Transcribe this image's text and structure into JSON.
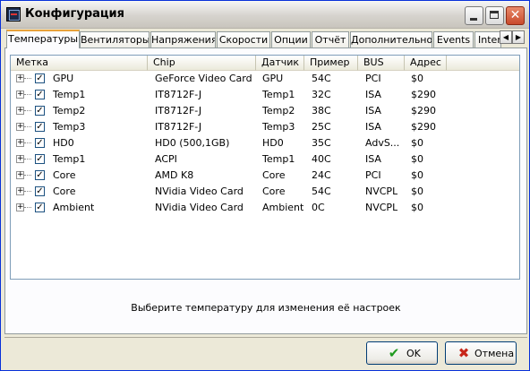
{
  "window": {
    "title": "Конфигурация",
    "icon": "app-config-icon"
  },
  "tabs": [
    {
      "label": "Температуры",
      "active": true
    },
    {
      "label": "Вентиляторы"
    },
    {
      "label": "Напряжения"
    },
    {
      "label": "Скорости"
    },
    {
      "label": "Опции"
    },
    {
      "label": "Отчёт"
    },
    {
      "label": "Дополнительно"
    },
    {
      "label": "Events"
    },
    {
      "label": "Internet"
    }
  ],
  "tab_scroll": {
    "left": "◀",
    "right": "▶"
  },
  "list": {
    "columns": [
      "Метка",
      "Chip",
      "Датчик",
      "Пример",
      "BUS",
      "Адрес"
    ],
    "rows": [
      {
        "label": "GPU",
        "chip": "GeForce Video Card",
        "sensor": "GPU",
        "sample": "54C",
        "bus": "PCI",
        "address": "$0",
        "checked": true
      },
      {
        "label": "Temp1",
        "chip": "IT8712F-J",
        "sensor": "Temp1",
        "sample": "32C",
        "bus": "ISA",
        "address": "$290",
        "checked": true
      },
      {
        "label": "Temp2",
        "chip": "IT8712F-J",
        "sensor": "Temp2",
        "sample": "38C",
        "bus": "ISA",
        "address": "$290",
        "checked": true
      },
      {
        "label": "Temp3",
        "chip": "IT8712F-J",
        "sensor": "Temp3",
        "sample": "25C",
        "bus": "ISA",
        "address": "$290",
        "checked": true
      },
      {
        "label": "HD0",
        "chip": "HD0 (500,1GB)",
        "sensor": "HD0",
        "sample": "35C",
        "bus": "AdvS...",
        "address": "$0",
        "checked": true
      },
      {
        "label": "Temp1",
        "chip": "ACPI",
        "sensor": "Temp1",
        "sample": "40C",
        "bus": "ISA",
        "address": "$0",
        "checked": true
      },
      {
        "label": "Core",
        "chip": "AMD K8",
        "sensor": "Core",
        "sample": "24C",
        "bus": "PCI",
        "address": "$0",
        "checked": true
      },
      {
        "label": "Core",
        "chip": "NVidia Video Card",
        "sensor": "Core",
        "sample": "54C",
        "bus": "NVCPL",
        "address": "$0",
        "checked": true
      },
      {
        "label": "Ambient",
        "chip": "NVidia Video Card",
        "sensor": "Ambient",
        "sample": "0C",
        "bus": "NVCPL",
        "address": "$0",
        "checked": true
      }
    ]
  },
  "hint": "Выберите температуру для изменения её настроек",
  "buttons": {
    "ok_label": "OK",
    "cancel_label": "Отмена"
  },
  "colors": {
    "tab_highlight": "#e8a23a",
    "ok_icon": "#1e9a1e",
    "cancel_icon": "#c8261a"
  }
}
